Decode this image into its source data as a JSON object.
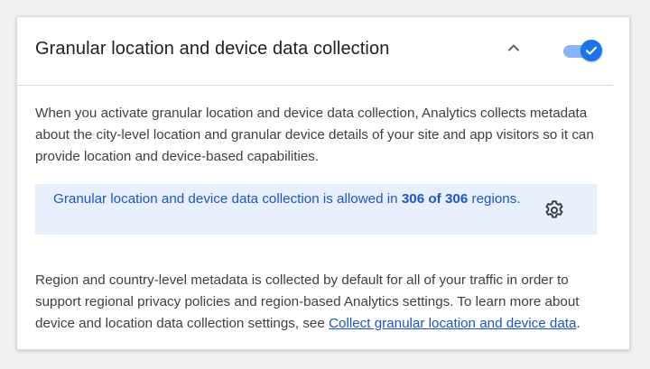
{
  "panel": {
    "title": "Granular location and device data collection",
    "collapse_icon": "chevron-up-icon",
    "toggle": {
      "state": "on",
      "icon": "check-icon"
    }
  },
  "description": "When you activate granular location and device data collection, Analytics collects metadata about the city-level location and granular device details of your site and app visitors so it can provide location and device-based capabilities.",
  "banner": {
    "text_before": "Granular location and device data collection is allowed in ",
    "count_text": "306 of 306",
    "text_after": " regions.",
    "settings_icon": "gear-icon"
  },
  "footer": {
    "text": "Region and country-level metadata is collected by default for all of your traffic in order to support regional privacy policies and region-based Analytics settings. To learn more about device and location data collection settings, see ",
    "link_text": "Collect granular location and device data",
    "text_end": "."
  },
  "colors": {
    "accent": "#1a73e8",
    "toggle_track": "#8ab4f8",
    "banner_bg": "#e8f0fe",
    "banner_text": "#1a56c9",
    "body_text": "#3c4043",
    "title_text": "#202124",
    "divider": "#dadce0"
  }
}
